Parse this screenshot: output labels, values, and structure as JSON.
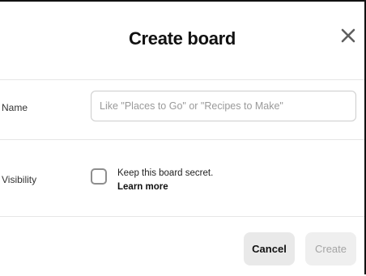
{
  "dialog": {
    "title": "Create board",
    "close_icon": "close-icon"
  },
  "name_field": {
    "label": "Name",
    "value": "",
    "placeholder": "Like \"Places to Go\" or \"Recipes to Make\""
  },
  "visibility": {
    "label": "Visibility",
    "checkbox_label": "Keep this board secret.",
    "checked": false,
    "learn_more": "Learn more"
  },
  "footer": {
    "cancel_label": "Cancel",
    "create_label": "Create",
    "create_enabled": false
  },
  "colors": {
    "primary_text": "#111111",
    "muted_text": "#9a9a9a",
    "button_bg": "#e9e9e9",
    "disabled_text": "#a4a4a4",
    "divider": "#e6e6e6"
  }
}
